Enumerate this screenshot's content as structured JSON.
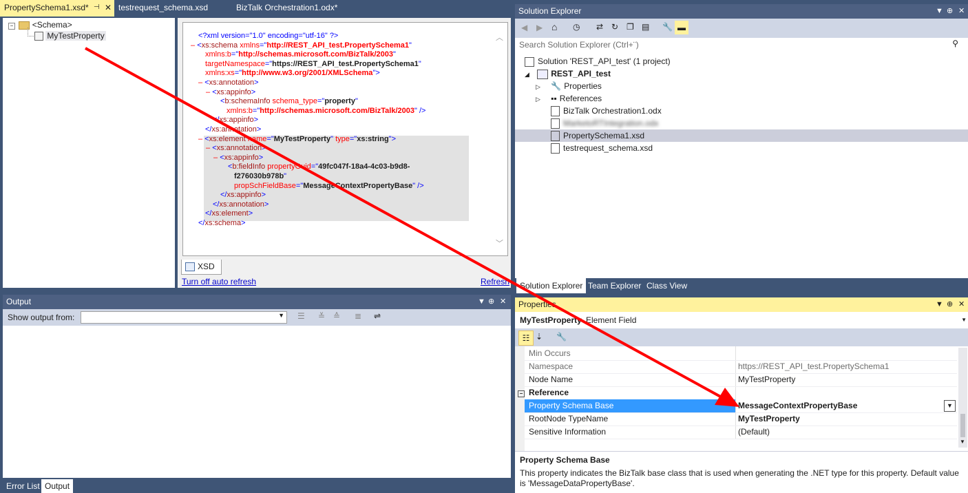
{
  "doc_tabs": [
    {
      "label": "PropertySchema1.xsd*"
    },
    {
      "label": "testrequest_schema.xsd"
    },
    {
      "label": "BizTalk Orchestration1.odx*"
    }
  ],
  "schema_tree": {
    "root": "<Schema>",
    "child": "MyTestProperty"
  },
  "xml": {
    "decl": "<?xml version=\"1.0\" encoding=\"utf-16\" ?>",
    "schema_open": "xs:schema",
    "xmlns_attr": "xmlns",
    "xmlns_val": "http://REST_API_test.PropertySchema1",
    "xmlnsb_attr": "xmlns:b",
    "xmlnsb_val": "http://schemas.microsoft.com/BizTalk/2003",
    "tns_attr": "targetNamespace",
    "tns_val": "https://REST_API_test.PropertySchema1",
    "xmlnsxs_attr": "xmlns:xs",
    "xmlnsxs_val": "http://www.w3.org/2001/XMLSchema",
    "annotation": "xs:annotation",
    "appinfo": "xs:appinfo",
    "schemainfo": "b:schemaInfo",
    "schema_type_attr": "schema_type",
    "schema_type_val": "property",
    "element": "xs:element",
    "name_attr": "name",
    "name_val": "MyTestProperty",
    "type_attr": "type",
    "type_val": "xs:string",
    "fieldinfo": "b:fieldInfo",
    "guid_attr": "propertyGuid",
    "guid_val1": "49fc047f-18a4-4c03-b9d8-",
    "guid_val2": "f276030b978b",
    "base_attr": "propSchFieldBase",
    "base_val": "MessageContextPropertyBase",
    "element_close": "xs:element",
    "schema_close": "xs:schema"
  },
  "xsd_tab": "XSD",
  "links": {
    "auto_refresh": "Turn off auto refresh",
    "refresh": "Refresh"
  },
  "output": {
    "title": "Output",
    "show_from": "Show output from:",
    "bottom_tabs": [
      "Error List",
      "Output"
    ]
  },
  "solution_explorer": {
    "title": "Solution Explorer",
    "search_placeholder": "Search Solution Explorer (Ctrl+¨)",
    "solution": "Solution 'REST_API_test' (1 project)",
    "project": "REST_API_test",
    "items": [
      "Properties",
      "References",
      "BizTalk Orchestration1.odx",
      "MarketoRTIntegration.odx",
      "PropertySchema1.xsd",
      "testrequest_schema.xsd"
    ],
    "bottom_tabs": [
      "Solution Explorer",
      "Team Explorer",
      "Class View"
    ]
  },
  "properties": {
    "title": "Properties",
    "object": "MyTestProperty",
    "object_type": "Element Field",
    "rows": [
      {
        "name": "Min Occurs",
        "value": ""
      },
      {
        "name": "Namespace",
        "value": "https://REST_API_test.PropertySchema1"
      },
      {
        "name": "Node Name",
        "value": "MyTestProperty"
      }
    ],
    "category": "Reference",
    "ref_rows": [
      {
        "name": "Property Schema Base",
        "value": "MessageContextPropertyBase"
      },
      {
        "name": "RootNode TypeName",
        "value": "MyTestProperty"
      },
      {
        "name": "Sensitive Information",
        "value": "(Default)"
      }
    ],
    "desc_title": "Property Schema Base",
    "desc_text": "This property indicates the BizTalk base class that is used when generating the .NET type for this property. Default value is 'MessageDataPropertyBase'."
  },
  "colors": {
    "accent": "#fff29d",
    "frame": "#3f5576",
    "selection": "#3399ff",
    "arrow": "#ff0000"
  }
}
